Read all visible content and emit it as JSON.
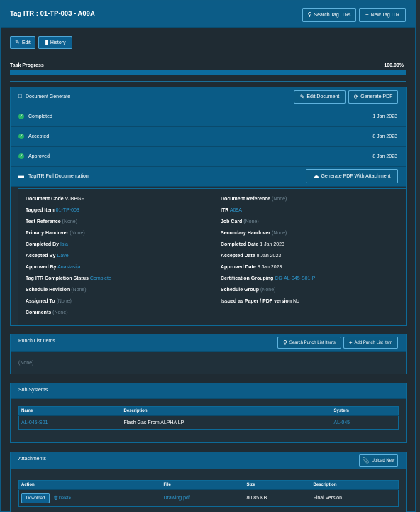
{
  "header": {
    "title": "Tag ITR : 01-TP-003 - A09A",
    "search_button": "Search Tag ITRs",
    "new_button": "New Tag ITR"
  },
  "toolbar": {
    "edit": "Edit",
    "history": "History"
  },
  "progress": {
    "label": "Task Progress",
    "value": "100.00%",
    "fraction": 1.0
  },
  "document_generate": {
    "title": "Document Generate",
    "edit_button": "Edit Document",
    "generate_button": "Generate PDF",
    "statuses": [
      {
        "label": "Completed",
        "date": "1 Jan 2023"
      },
      {
        "label": "Accepted",
        "date": "8 Jan 2023"
      },
      {
        "label": "Approved",
        "date": "8 Jan 2023"
      }
    ],
    "full_doc_label": "TagITR Full Documentation",
    "full_doc_button": "Generate PDF With Attachment"
  },
  "details": {
    "left": [
      {
        "key": "Document Code",
        "value": "VJBBGF",
        "kind": "plain"
      },
      {
        "key": "Tagged Item",
        "value": "01-TP-003",
        "kind": "link"
      },
      {
        "key": "Test Reference",
        "value": "(None)",
        "kind": "none"
      },
      {
        "key": "Primary Handover",
        "value": "(None)",
        "kind": "none"
      },
      {
        "key": "Completed By",
        "value": "Isla",
        "kind": "link"
      },
      {
        "key": "Accepted By",
        "value": "Dave",
        "kind": "link"
      },
      {
        "key": "Approved By",
        "value": "Anastasija",
        "kind": "link"
      },
      {
        "key": "Tag ITR Completion Status",
        "value": "Complete",
        "kind": "link"
      },
      {
        "key": "Schedule Revision",
        "value": "(None)",
        "kind": "none"
      },
      {
        "key": "Assigned To",
        "value": "(None)",
        "kind": "none"
      },
      {
        "key": "Comments",
        "value": "(None)",
        "kind": "none"
      }
    ],
    "right": [
      {
        "key": "Document Reference",
        "value": "(None)",
        "kind": "none"
      },
      {
        "key": "ITR",
        "value": "A09A",
        "kind": "link"
      },
      {
        "key": "Job Card",
        "value": "(None)",
        "kind": "none"
      },
      {
        "key": "Secondary Handover",
        "value": "(None)",
        "kind": "none"
      },
      {
        "key": "Completed Date",
        "value": "1 Jan 2023",
        "kind": "plain"
      },
      {
        "key": "Accepted Date",
        "value": "8 Jan 2023",
        "kind": "plain"
      },
      {
        "key": "Approved Date",
        "value": "8 Jan 2023",
        "kind": "plain"
      },
      {
        "key": "Certification Grouping",
        "value": "CG-AL-045-S01-P",
        "kind": "link"
      },
      {
        "key": "Schedule Group",
        "value": "(None)",
        "kind": "none"
      },
      {
        "key": "Issued as Paper / PDF version",
        "value": "No",
        "kind": "plain"
      }
    ]
  },
  "punch_list": {
    "title": "Punch List Items",
    "search_button": "Search Punch List Items",
    "add_button": "Add Punch List Item",
    "empty": "(None)"
  },
  "sub_systems": {
    "title": "Sub Systems",
    "columns": [
      "Name",
      "Description",
      "System"
    ],
    "rows": [
      {
        "name": "AL-045-S01",
        "description": "Flash Gas From ALPHA LP",
        "system": "AL-045"
      }
    ]
  },
  "attachments": {
    "title": "Attachments",
    "upload_button": "Upload New",
    "columns": [
      "Action",
      "File",
      "Size",
      "Description"
    ],
    "rows": [
      {
        "download": "Download",
        "delete": "Delete",
        "file": "Drawing.pdf",
        "size": "80.85 KB",
        "description": "Final Version"
      }
    ]
  },
  "colors": {
    "accent": "#0c5c87",
    "link": "#2d9ad2",
    "success": "#27b36a",
    "muted": "#6f8592"
  }
}
